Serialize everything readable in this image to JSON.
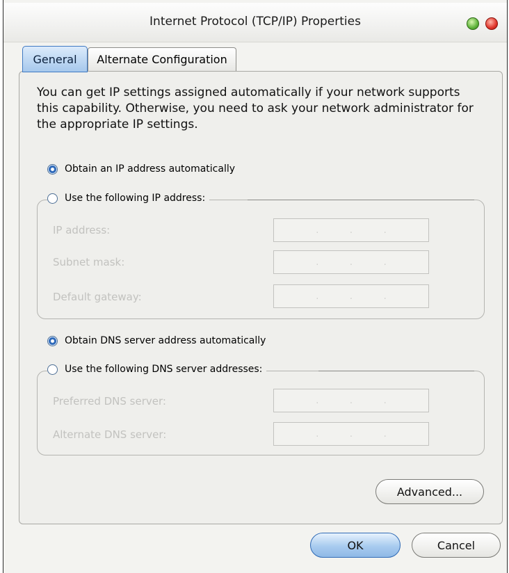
{
  "window": {
    "title": "Internet Protocol (TCP/IP) Properties",
    "controls": [
      "minimize-icon",
      "close-icon"
    ],
    "colors": {
      "minimize": "#5eb33a",
      "close": "#e0352b",
      "accent": "#3f79c2"
    }
  },
  "tabs": [
    {
      "label": "General",
      "selected": true
    },
    {
      "label": "Alternate Configuration",
      "selected": false
    }
  ],
  "general": {
    "description": "You can get IP settings assigned automatically if your network supports this capability. Otherwise, you need to ask your network administrator for the appropriate IP settings.",
    "ip": {
      "auto_label": "Obtain an IP address automatically",
      "manual_label": "Use the following IP address:",
      "auto_selected": true,
      "fields": [
        {
          "label": "IP address:",
          "value": " .  .  . "
        },
        {
          "label": "Subnet mask:",
          "value": " .  .  . "
        },
        {
          "label": "Default gateway:",
          "value": " .  .  . "
        }
      ]
    },
    "dns": {
      "auto_label": "Obtain DNS server address automatically",
      "manual_label": "Use the following DNS server addresses:",
      "auto_selected": true,
      "fields": [
        {
          "label": "Preferred DNS server:",
          "value": " .  .  . "
        },
        {
          "label": "Alternate DNS server:",
          "value": " .  .  . "
        }
      ]
    },
    "advanced_label": "Advanced..."
  },
  "footer": {
    "ok_label": "OK",
    "cancel_label": "Cancel"
  }
}
